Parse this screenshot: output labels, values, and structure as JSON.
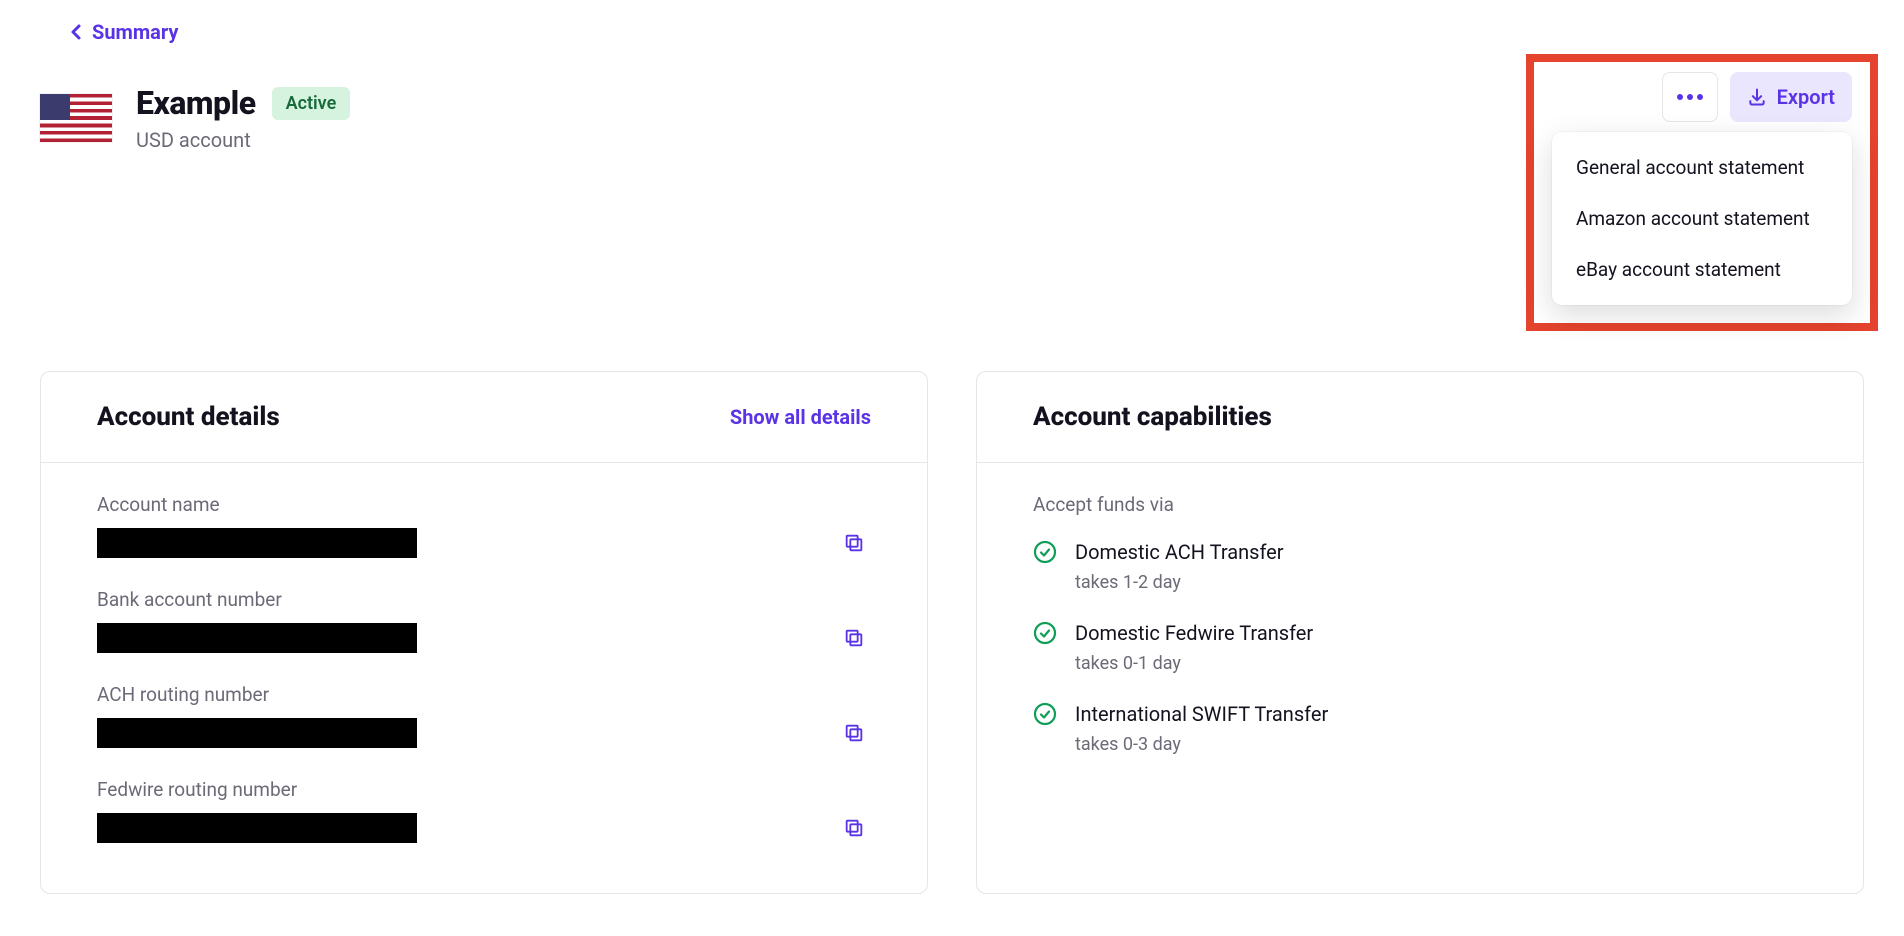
{
  "breadcrumb": {
    "label": "Summary"
  },
  "header": {
    "title": "Example",
    "subtitle": "USD account",
    "status": "Active"
  },
  "actions": {
    "export_label": "Export",
    "dropdown": {
      "item0": "General account statement",
      "item1": "Amazon account statement",
      "item2": "eBay account statement"
    }
  },
  "details": {
    "card_title": "Account details",
    "show_all": "Show all details",
    "fields": {
      "f0": {
        "label": "Account name"
      },
      "f1": {
        "label": "Bank account number"
      },
      "f2": {
        "label": "ACH routing number"
      },
      "f3": {
        "label": "Fedwire routing number"
      }
    }
  },
  "capabilities": {
    "card_title": "Account capabilities",
    "accept_label": "Accept funds via",
    "items": {
      "c0": {
        "name": "Domestic ACH Transfer",
        "note": "takes 1-2 day"
      },
      "c1": {
        "name": "Domestic Fedwire Transfer",
        "note": "takes 0-1 day"
      },
      "c2": {
        "name": "International SWIFT Transfer",
        "note": "takes 0-3 day"
      }
    }
  }
}
